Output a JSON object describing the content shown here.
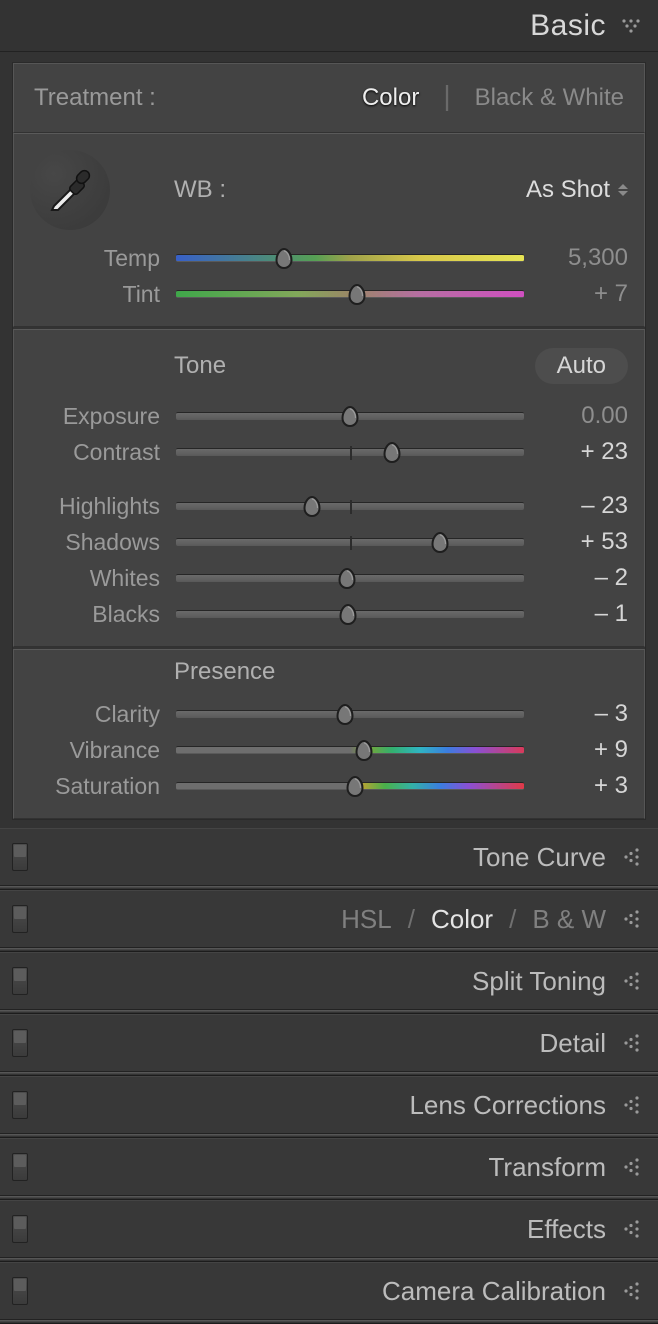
{
  "header": {
    "title": "Basic"
  },
  "treatment": {
    "label": "Treatment :",
    "color": "Color",
    "bw": "Black & White",
    "active": "color"
  },
  "wb": {
    "label": "WB :",
    "preset": "As Shot",
    "temp": {
      "label": "Temp",
      "value": "5,300",
      "pos": 31
    },
    "tint": {
      "label": "Tint",
      "value": "+ 7",
      "pos": 52
    }
  },
  "tone": {
    "label": "Tone",
    "auto": "Auto",
    "exposure": {
      "label": "Exposure",
      "value": "0.00",
      "pos": 50
    },
    "contrast": {
      "label": "Contrast",
      "value": "+ 23",
      "pos": 62
    }
  },
  "tone2": {
    "highlights": {
      "label": "Highlights",
      "value": "– 23",
      "pos": 39
    },
    "shadows": {
      "label": "Shadows",
      "value": "+ 53",
      "pos": 76
    },
    "whites": {
      "label": "Whites",
      "value": "– 2",
      "pos": 49
    },
    "blacks": {
      "label": "Blacks",
      "value": "– 1",
      "pos": 49.5
    }
  },
  "presence": {
    "label": "Presence",
    "clarity": {
      "label": "Clarity",
      "value": "– 3",
      "pos": 48.5
    },
    "vibrance": {
      "label": "Vibrance",
      "value": "+ 9",
      "pos": 54
    },
    "saturation": {
      "label": "Saturation",
      "value": "+ 3",
      "pos": 51.5
    }
  },
  "collapsed": {
    "tone_curve": "Tone Curve",
    "hsl": {
      "hsl": "HSL",
      "color": "Color",
      "bw": "B & W"
    },
    "split_toning": "Split Toning",
    "detail": "Detail",
    "lens": "Lens Corrections",
    "transform": "Transform",
    "effects": "Effects",
    "calibration": "Camera Calibration"
  }
}
